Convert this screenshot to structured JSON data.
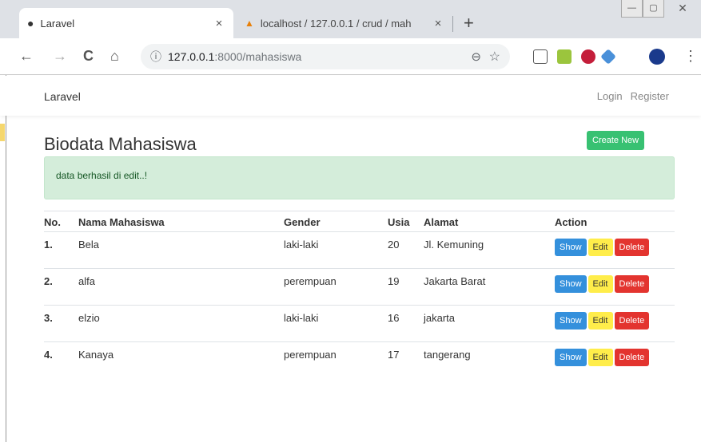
{
  "browser": {
    "tabs": [
      {
        "title": "Laravel",
        "close": "×"
      },
      {
        "title": "localhost / 127.0.0.1 / crud / mah",
        "close": "×"
      }
    ],
    "new_tab": "+",
    "window_controls": {
      "minimize": "—",
      "maximize": "▢",
      "close": "✕"
    },
    "nav": {
      "back": "←",
      "forward": "→",
      "reload": "C",
      "home": "⌂"
    },
    "url": {
      "host": "127.0.0.1",
      "path": ":8000/mahasiswa",
      "info": "ⓘ"
    },
    "zoom_icon": "⊖",
    "bookmark_icon": "☆",
    "menu_icon": "⋮"
  },
  "navbar": {
    "brand": "Laravel",
    "links": [
      "Login",
      "Register"
    ]
  },
  "page": {
    "heading": "Biodata Mahasiswa",
    "create_button": "Create New",
    "alert": "data berhasil di edit..!",
    "columns": [
      "No.",
      "Nama Mahasiswa",
      "Gender",
      "Usia",
      "Alamat",
      "Action"
    ],
    "rows": [
      {
        "no": "1.",
        "nama": "Bela",
        "gender": "laki-laki",
        "usia": "20",
        "alamat": "Jl. Kemuning"
      },
      {
        "no": "2.",
        "nama": "alfa",
        "gender": "perempuan",
        "usia": "19",
        "alamat": "Jakarta Barat"
      },
      {
        "no": "3.",
        "nama": "elzio",
        "gender": "laki-laki",
        "usia": "16",
        "alamat": "jakarta"
      },
      {
        "no": "4.",
        "nama": "Kanaya",
        "gender": "perempuan",
        "usia": "17",
        "alamat": "tangerang"
      }
    ],
    "actions": {
      "show": "Show",
      "edit": "Edit",
      "delete": "Delete"
    }
  },
  "colors": {
    "success": "#38c172",
    "primary": "#3490dc",
    "warning": "#ffed4a",
    "danger": "#e3342f"
  }
}
